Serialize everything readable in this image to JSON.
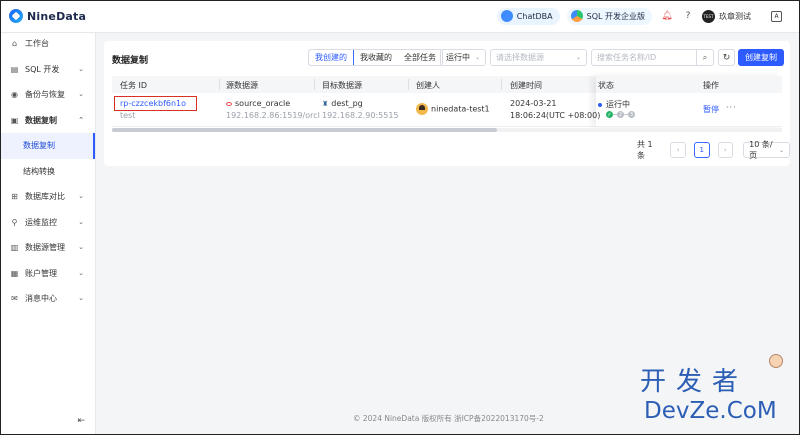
{
  "header": {
    "brand": "NineData",
    "chatdba": "ChatDBA",
    "sql_edition": "SQL 开发企业版",
    "user_badge": "TEST",
    "user_name": "玖章测试"
  },
  "sidebar": {
    "items": [
      {
        "label": "工作台",
        "icon": "home-icon"
      },
      {
        "label": "SQL 开发",
        "icon": "sql-icon"
      },
      {
        "label": "备份与恢复",
        "icon": "backup-icon"
      },
      {
        "label": "数据复制",
        "icon": "replication-icon"
      },
      {
        "label": "数据复制"
      },
      {
        "label": "结构转换"
      },
      {
        "label": "数据库对比",
        "icon": "compare-icon"
      },
      {
        "label": "运维监控",
        "icon": "monitor-icon"
      },
      {
        "label": "数据源管理",
        "icon": "datasource-icon"
      },
      {
        "label": "账户管理",
        "icon": "account-icon"
      },
      {
        "label": "消息中心",
        "icon": "message-icon"
      }
    ]
  },
  "main": {
    "title": "数据复制",
    "tabs": [
      "我创建的",
      "我收藏的",
      "全部任务"
    ],
    "status_filter": "运行中",
    "datasource_placeholder": "请选择数据源",
    "search_placeholder": "搜索任务名称/ID",
    "create_button": "创建复制",
    "columns": [
      "任务 ID",
      "源数据源",
      "目标数据源",
      "创建人",
      "创建时间",
      "状态",
      "操作"
    ],
    "row": {
      "task_id": "rp-czzcekbf6n1o",
      "task_name": "test",
      "source_name": "source_oracle",
      "source_addr": "192.168.2.86:1519/orcl",
      "target_name": "dest_pg",
      "target_addr": "192.168.2.90:5515",
      "creator": "ninedata-test1",
      "created_date": "2024-03-21",
      "created_time": "18:06:24(UTC +08:00)",
      "status": "运行中",
      "steps": [
        "✓",
        "2",
        "3"
      ],
      "action_pause": "暂停",
      "action_more": "···"
    },
    "pagination": {
      "total": "共 1 条",
      "current": "1",
      "page_size": "10 条/页"
    }
  },
  "footer": "© 2024 NineData 版权所有    浙ICP备2022013170号-2",
  "watermark": {
    "cn": "开发者",
    "en": "DevZe.CoM"
  }
}
